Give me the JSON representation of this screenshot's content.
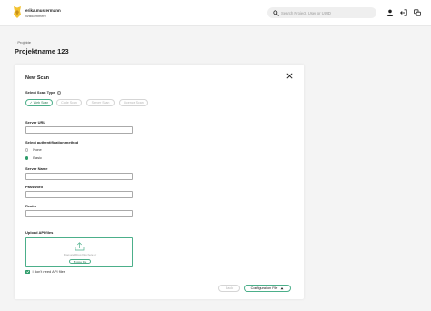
{
  "header": {
    "user_name": "erika.mustermann",
    "welcome": "Willkommen!",
    "search_placeholder": "Search Project, User or UUID",
    "icons": [
      "user-icon",
      "logout-icon",
      "language-icon"
    ]
  },
  "breadcrumb": {
    "label": "Projekte"
  },
  "page": {
    "title": "Projektname 123"
  },
  "modal": {
    "title": "New Scan",
    "scan_type_label": "Select Scan Type",
    "scan_types": [
      {
        "label": "Web Scan",
        "active": true
      },
      {
        "label": "Code Scan",
        "active": false
      },
      {
        "label": "Server Scan",
        "active": false
      },
      {
        "label": "Licence Scan",
        "active": false
      }
    ],
    "server_url_label": "Server URL",
    "server_url_value": "",
    "auth_label": "Select authentification method",
    "auth_options": [
      {
        "label": "None",
        "selected": false
      },
      {
        "label": "Basic",
        "selected": true
      }
    ],
    "server_name_label": "Server Name",
    "password_label": "Password",
    "realm_label": "Realm",
    "upload_label": "Upload API files",
    "upload_hint": "Drag and Drop files here or",
    "browse_label": "Browse File",
    "no_api_checkbox_label": "I don't need API files",
    "no_api_checked": true,
    "back_button": "Back",
    "config_button": "Configuration File"
  },
  "colors": {
    "accent": "#2e9c6a",
    "accent_border": "#4caf8a",
    "disabled": "#b5b5b5"
  }
}
